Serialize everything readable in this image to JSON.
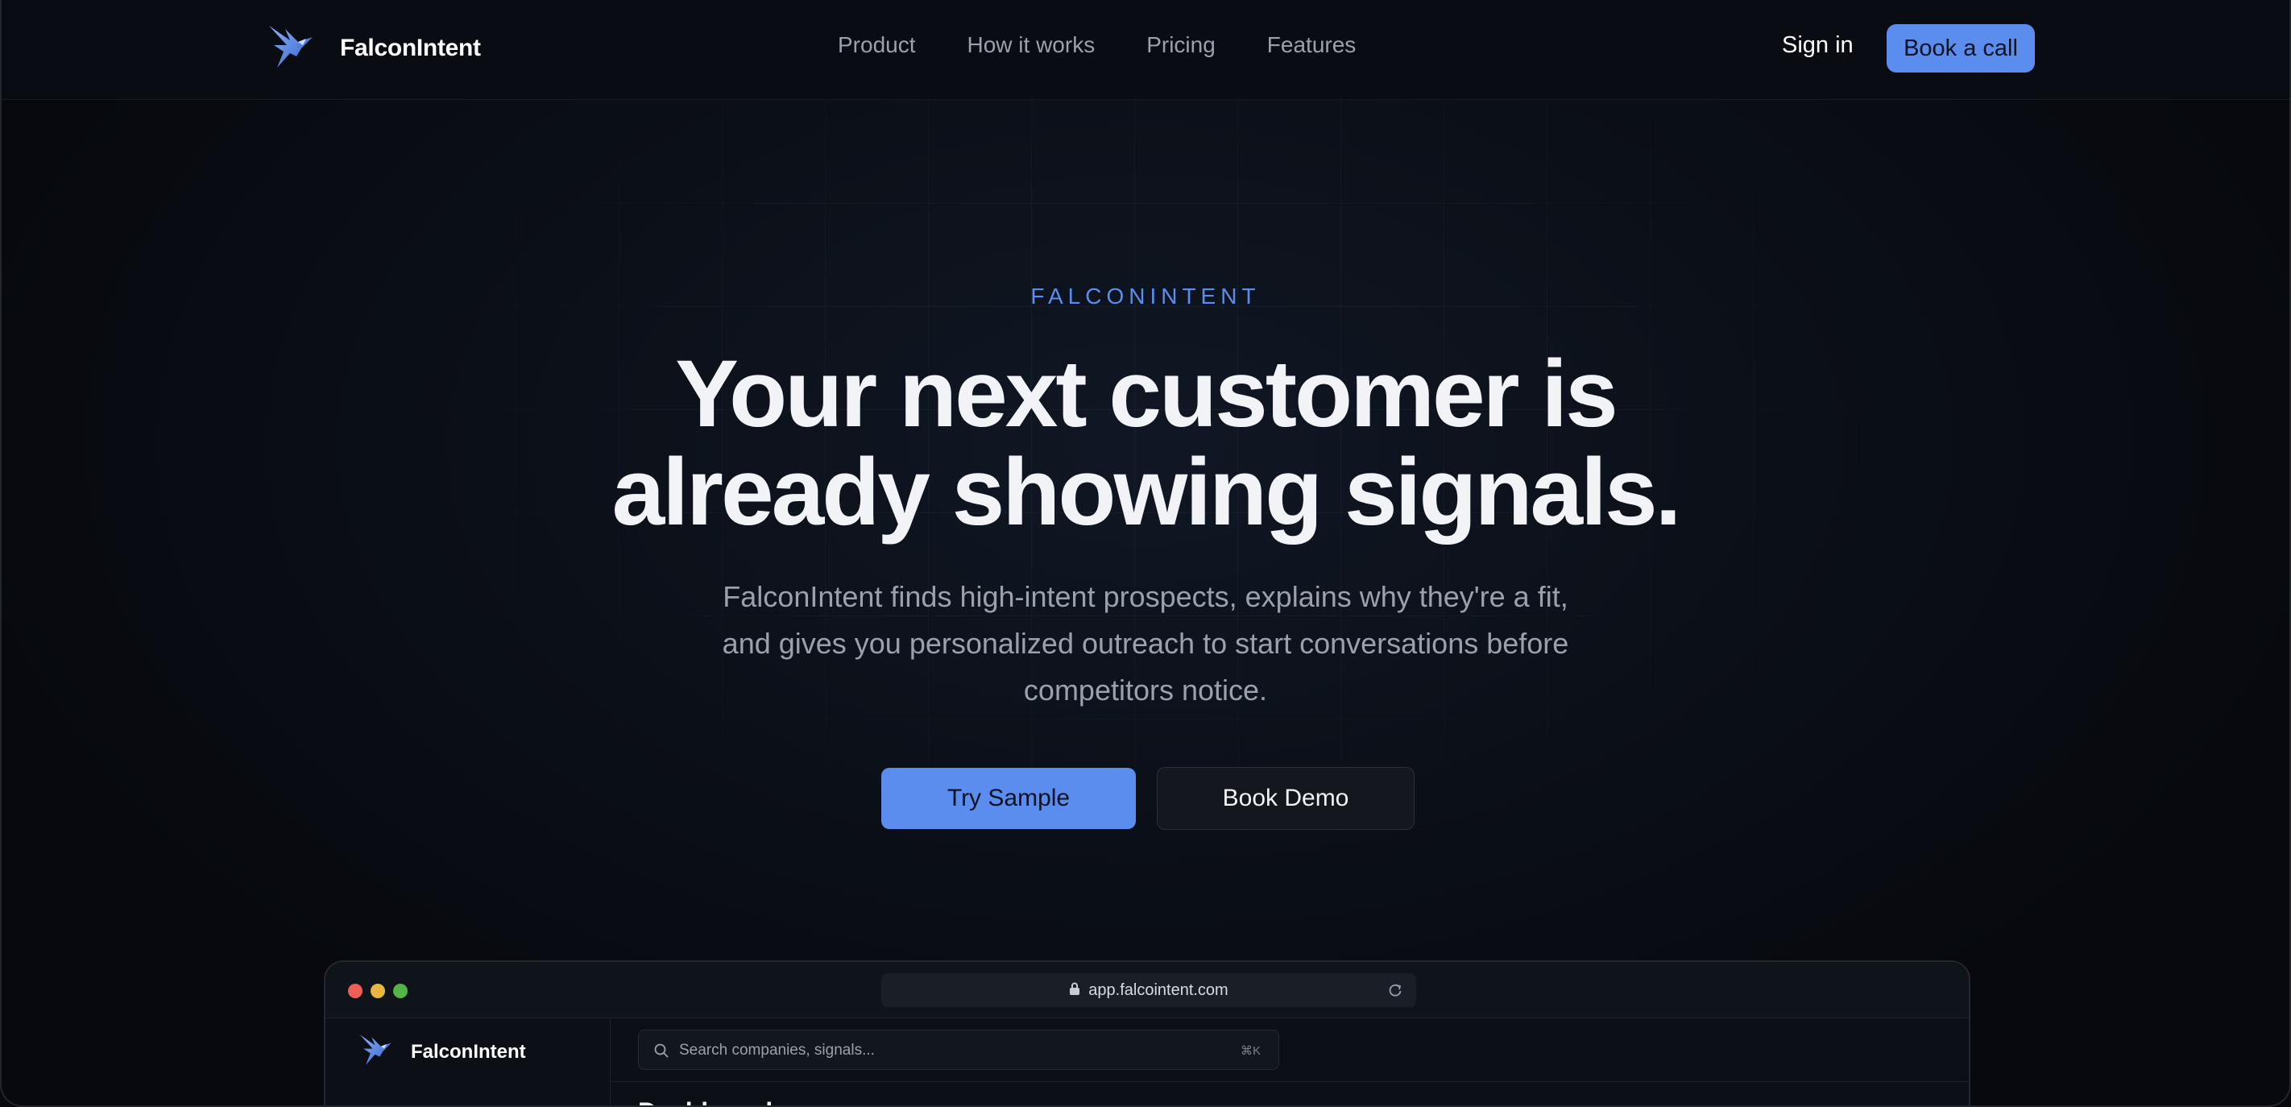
{
  "nav": {
    "brand": "FalconIntent",
    "links": [
      "Product",
      "How it works",
      "Pricing",
      "Features"
    ],
    "signin": "Sign in",
    "cta": "Book a call"
  },
  "hero": {
    "eyebrow": "FALCONINTENT",
    "headline_line1": "Your next customer is",
    "headline_line2": "already showing signals.",
    "subtext_line1": "FalconIntent finds high-intent prospects, explains why they're a fit,",
    "subtext_line2": "and gives you personalized outreach to start conversations before",
    "subtext_line3": "competitors notice.",
    "primary_button": "Try Sample",
    "secondary_button": "Book Demo"
  },
  "preview": {
    "url": "app.falcointent.com",
    "brand": "FalconIntent",
    "search_placeholder": "Search companies, signals...",
    "search_shortcut": "⌘K",
    "page_title": "Dashboard"
  },
  "colors": {
    "accent": "#5b8def",
    "background": "#080b11",
    "text_muted": "#9aa1ad"
  },
  "icons": [
    "falcon-logo-icon",
    "lock-icon",
    "reload-icon",
    "search-icon"
  ]
}
